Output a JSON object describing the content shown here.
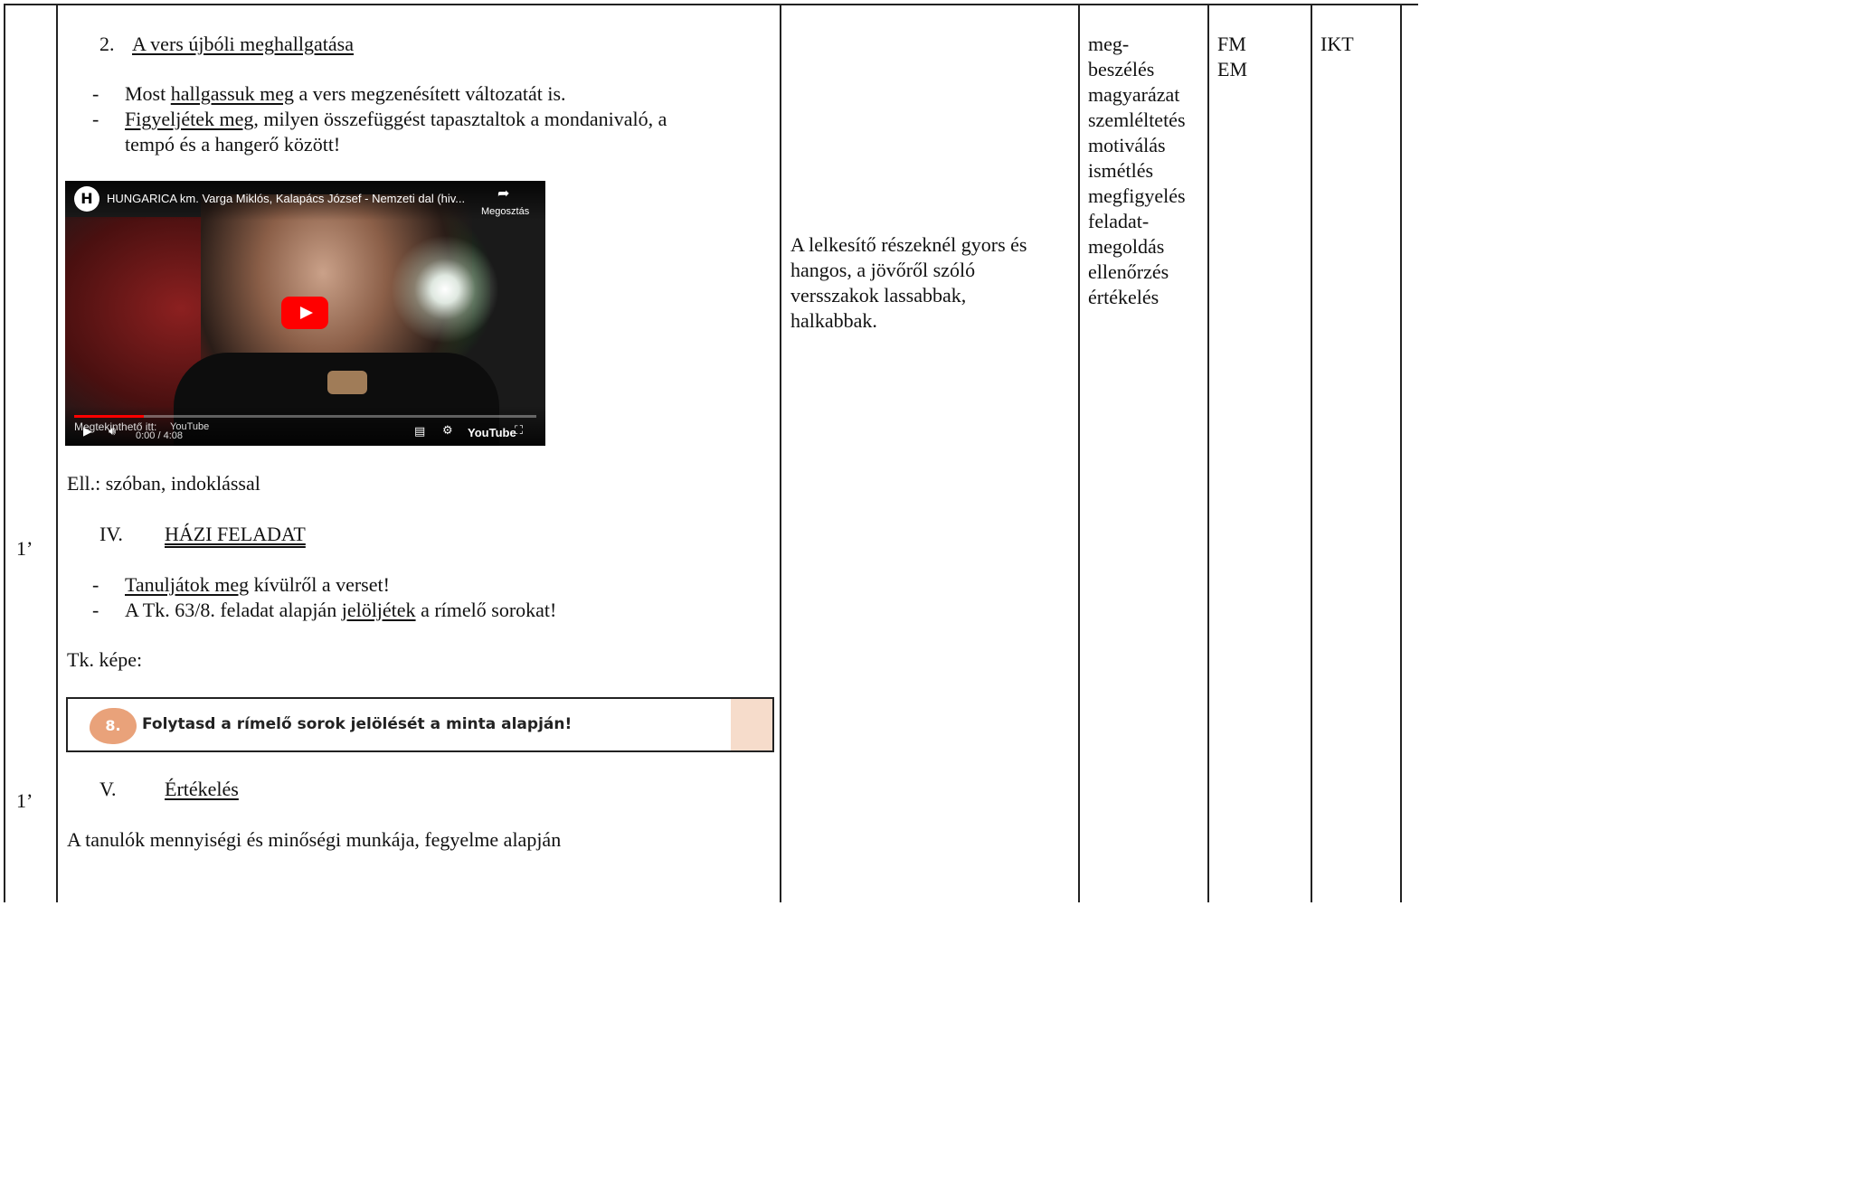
{
  "time_col": {
    "row1": "1’",
    "row2": "1’"
  },
  "section2": {
    "number": "2.",
    "title": "A vers újbóli meghallgatása",
    "bullet1_underlined": "hallgassuk meg",
    "bullet1_prefix": "Most ",
    "bullet1_suffix": " a vers megzenésített változatát is.",
    "bullet2_underlined": "Figyeljétek meg",
    "bullet2_suffix": ", milyen összefüggést tapasztaltok a mondanivaló, a",
    "bullet2_line2": "tempó és a hangerő között!",
    "dash": "-"
  },
  "video": {
    "channel_initial": "H",
    "title": "HUNGARICA km. Varga Miklós, Kalapács József - Nemzeti dal (hiv...",
    "share_label": "Megosztás",
    "watch_on": "Megtekinthető itt:",
    "watch_on_brand": "YouTube",
    "time": "0:00 / 4:08",
    "brand": "YouTube",
    "progress": 0.15
  },
  "check1": "Ell.: szóban, indoklással",
  "section4": {
    "number": "IV.",
    "title": "HÁZI FELADAT",
    "b1_underlined": "Tanuljátok meg",
    "b1_suffix": " kívülről a verset!",
    "b2_prefix": "A Tk. 63/8. feladat alapján ",
    "b2_underlined": "jelöljétek",
    "b2_suffix": " a rímelő sorokat!"
  },
  "tk_label": "Tk. képe:",
  "exercise": {
    "number": "8.",
    "text": "Folytasd a rímelő sorok jelölését a minta alapján!"
  },
  "section5": {
    "number": "V.",
    "title": "Értékelés",
    "text": "A tanulók mennyiségi és minőségi munkája, fegyelme alapján"
  },
  "note_col": [
    "A lelkesítő részeknél gyors és",
    "hangos, a jövőről szóló",
    "versszakok lassabbak,",
    "halkabbak."
  ],
  "methods_col": [
    "meg-",
    "beszélés",
    "magyarázat",
    "szemléltetés",
    "motiválás",
    "ismétlés",
    "megfigyelés",
    "feladat-",
    "megoldás",
    "ellenőrzés",
    "értékelés"
  ],
  "forms_col": [
    "FM",
    "EM"
  ],
  "tools_col": [
    "IKT"
  ]
}
